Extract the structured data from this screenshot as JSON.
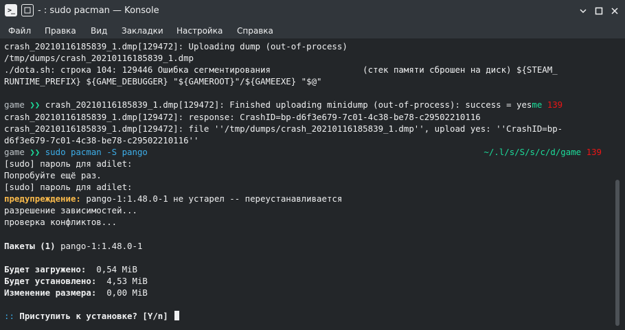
{
  "window": {
    "title": "- : sudo pacman — Konsole",
    "app_icon": ">_"
  },
  "menu": [
    "Файл",
    "Правка",
    "Вид",
    "Закладки",
    "Настройка",
    "Справка"
  ],
  "terminal": {
    "l1": "crash_20210116185839_1.dmp[129472]: Uploading dump (out-of-process)",
    "l2": "/tmp/dumps/crash_20210116185839_1.dmp",
    "l3": "./dota.sh: строка 104: 129446 Ошибка сегментирования                  (стек памяти сброшен на диск) ${STEAM_",
    "l4": "RUNTIME_PREFIX} ${GAME_DEBUGGER} \"${GAMEROOT}\"/${GAMEEXE} \"$@\"",
    "p1_dir": "game",
    "p1_arrow": "❯❯",
    "p1_text": " crash_20210116185839_1.dmp[129472]: Finished uploading minidump (out-of-process): success = yes",
    "p1_tail": "me",
    "p1_status": "139",
    "l7": "crash_20210116185839_1.dmp[129472]: response: CrashID=bp-d6f3e679-7c01-4c38-be78-c29502210116",
    "l8": "crash_20210116185839_1.dmp[129472]: file ''/tmp/dumps/crash_20210116185839_1.dmp'', upload yes: ''CrashID=bp-",
    "l9": "d6f3e679-7c01-4c38-be78-c29502210116''",
    "p2_dir": "game",
    "p2_arrow": "❯❯",
    "p2_cmd": " sudo pacman -S pango",
    "p2_path": "~/.l/s/S/s/c/d/game",
    "p2_status": "139",
    "l11": "[sudo] пароль для adilet:",
    "l12": "Попробуйте ещё раз.",
    "l13": "[sudo] пароль для adilet:",
    "warn_label": "предупреждение:",
    "warn_text": " pango-1:1.48.0-1 не устарел -- переустанавливается",
    "l15": "разрешение зависимостей...",
    "l16": "проверка конфликтов...",
    "pkg_label": "Пакеты (1)",
    "pkg_value": " pango-1:1.48.0-1",
    "dl_label": "Будет загружено:",
    "dl_value": "  0,54 MiB",
    "inst_label": "Будет установлено:",
    "inst_value": "  4,53 MiB",
    "chg_label": "Изменение размера:",
    "chg_value": "  0,00 MiB",
    "ask_prefix": "::",
    "ask_text": " Приступить к установке? [Y/n] "
  }
}
